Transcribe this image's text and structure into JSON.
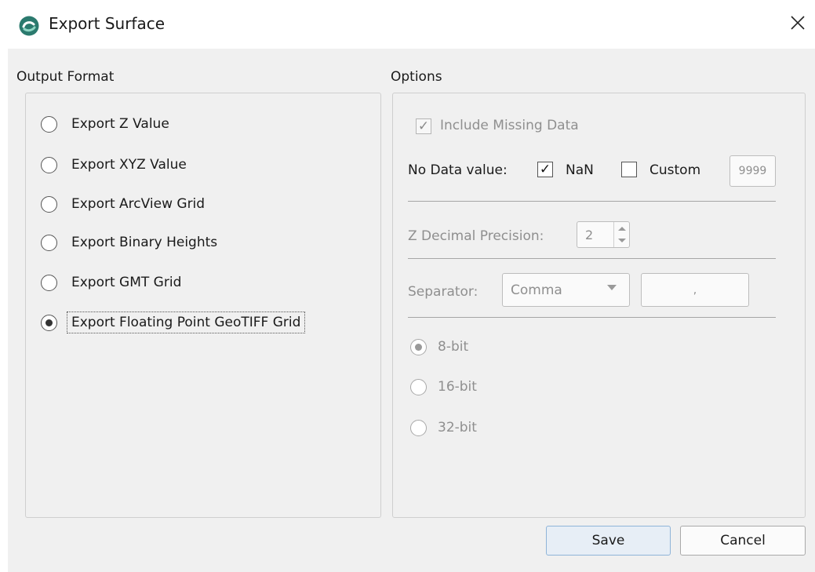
{
  "window": {
    "title": "Export Surface",
    "close_icon": "close-icon",
    "app_icon": "app-logo-icon"
  },
  "output_format": {
    "label": "Output Format",
    "options": [
      {
        "label": "Export Z Value",
        "selected": false
      },
      {
        "label": "Export XYZ Value",
        "selected": false
      },
      {
        "label": "Export ArcView Grid",
        "selected": false
      },
      {
        "label": "Export Binary Heights",
        "selected": false
      },
      {
        "label": "Export GMT Grid",
        "selected": false
      },
      {
        "label": "Export Floating Point GeoTIFF Grid",
        "selected": true
      }
    ]
  },
  "options": {
    "label": "Options",
    "include_missing": {
      "label": "Include Missing Data",
      "checked": true,
      "enabled": false
    },
    "no_data": {
      "label": "No Data value:",
      "nan": {
        "label": "NaN",
        "checked": true
      },
      "custom": {
        "label": "Custom",
        "checked": false
      },
      "custom_value": "9999"
    },
    "z_precision": {
      "label": "Z Decimal Precision:",
      "value": "2"
    },
    "separator": {
      "label": "Separator:",
      "selected": "Comma",
      "custom_value": ","
    },
    "bit_depth": [
      {
        "label": "8-bit",
        "selected": true
      },
      {
        "label": "16-bit",
        "selected": false
      },
      {
        "label": "32-bit",
        "selected": false
      }
    ]
  },
  "buttons": {
    "save": "Save",
    "cancel": "Cancel"
  },
  "colors": {
    "accent_border": "#8fb4d8",
    "save_bg": "#e7eef6",
    "dialog_bg": "#f0f0f0",
    "disabled_text": "#8f8f8f"
  }
}
